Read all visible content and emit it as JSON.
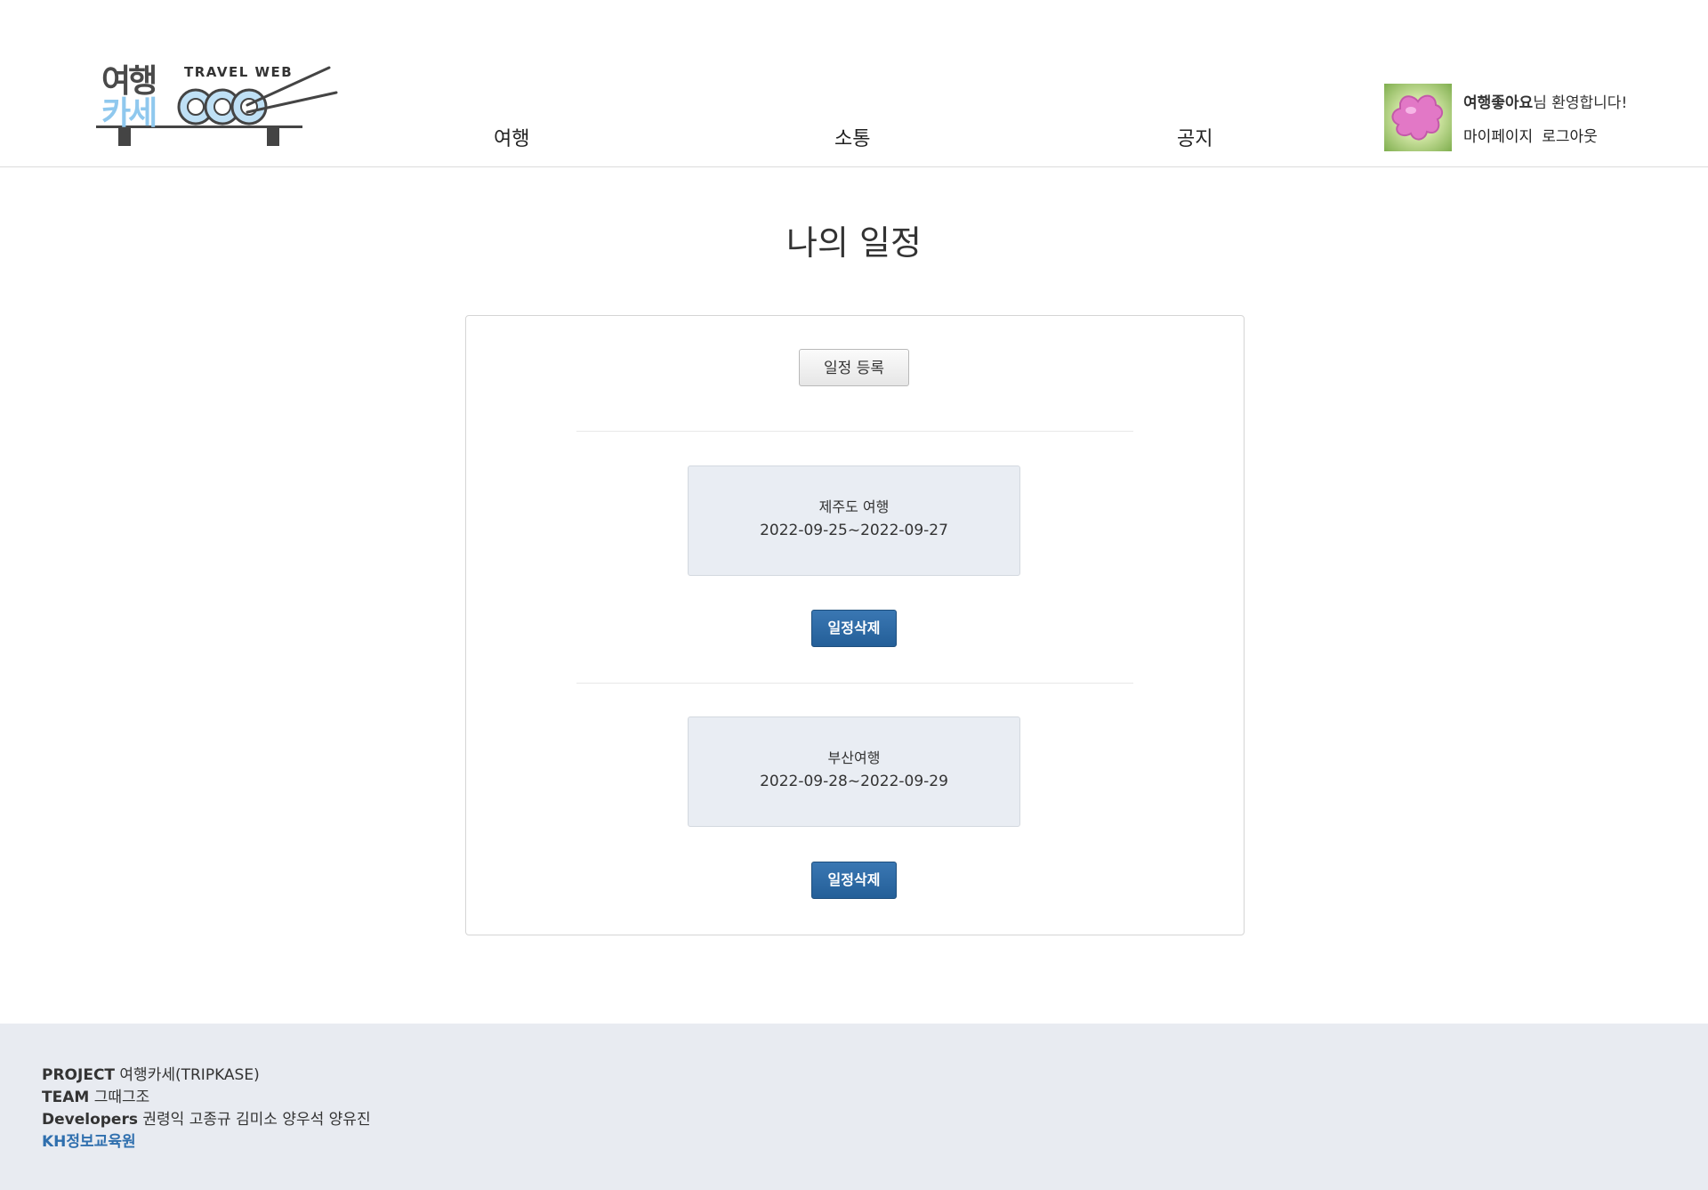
{
  "brand": {
    "logo_line1": "여행",
    "logo_line2": "카세",
    "logo_sub": "TRAVEL WEB",
    "colors": {
      "logo_dark": "#4a4a4a",
      "logo_blue": "#8fc8ee"
    }
  },
  "nav": {
    "items": [
      {
        "label": "여행"
      },
      {
        "label": "소통"
      },
      {
        "label": "공지"
      }
    ]
  },
  "user": {
    "nickname": "여행좋아요",
    "greeting_suffix": "님 환영합니다!",
    "mypage_label": "마이페이지",
    "logout_label": "로그아웃",
    "avatar_icon": "pink-blob-avatar-icon"
  },
  "main": {
    "title": "나의 일정",
    "register_label": "일정 등록",
    "schedules": [
      {
        "name": "제주도 여행",
        "dates": "2022-09-25~2022-09-27",
        "delete_label": "일정삭제"
      },
      {
        "name": "부산여행",
        "dates": "2022-09-28~2022-09-29",
        "delete_label": "일정삭제"
      }
    ],
    "colors": {
      "delete_button": "#2d6aa6",
      "card_bg": "#e9edf3"
    }
  },
  "footer": {
    "project_label": "PROJECT",
    "project_value": "여행카세(TRIPKASE)",
    "team_label": "TEAM",
    "team_value": "그때그조",
    "developers_label": "Developers",
    "developers_value": "권령익 고종규 김미소 양우석 양유진",
    "institute_link": "KH정보교육원",
    "colors": {
      "background": "#e8ebf1",
      "link": "#2f6fae"
    }
  }
}
